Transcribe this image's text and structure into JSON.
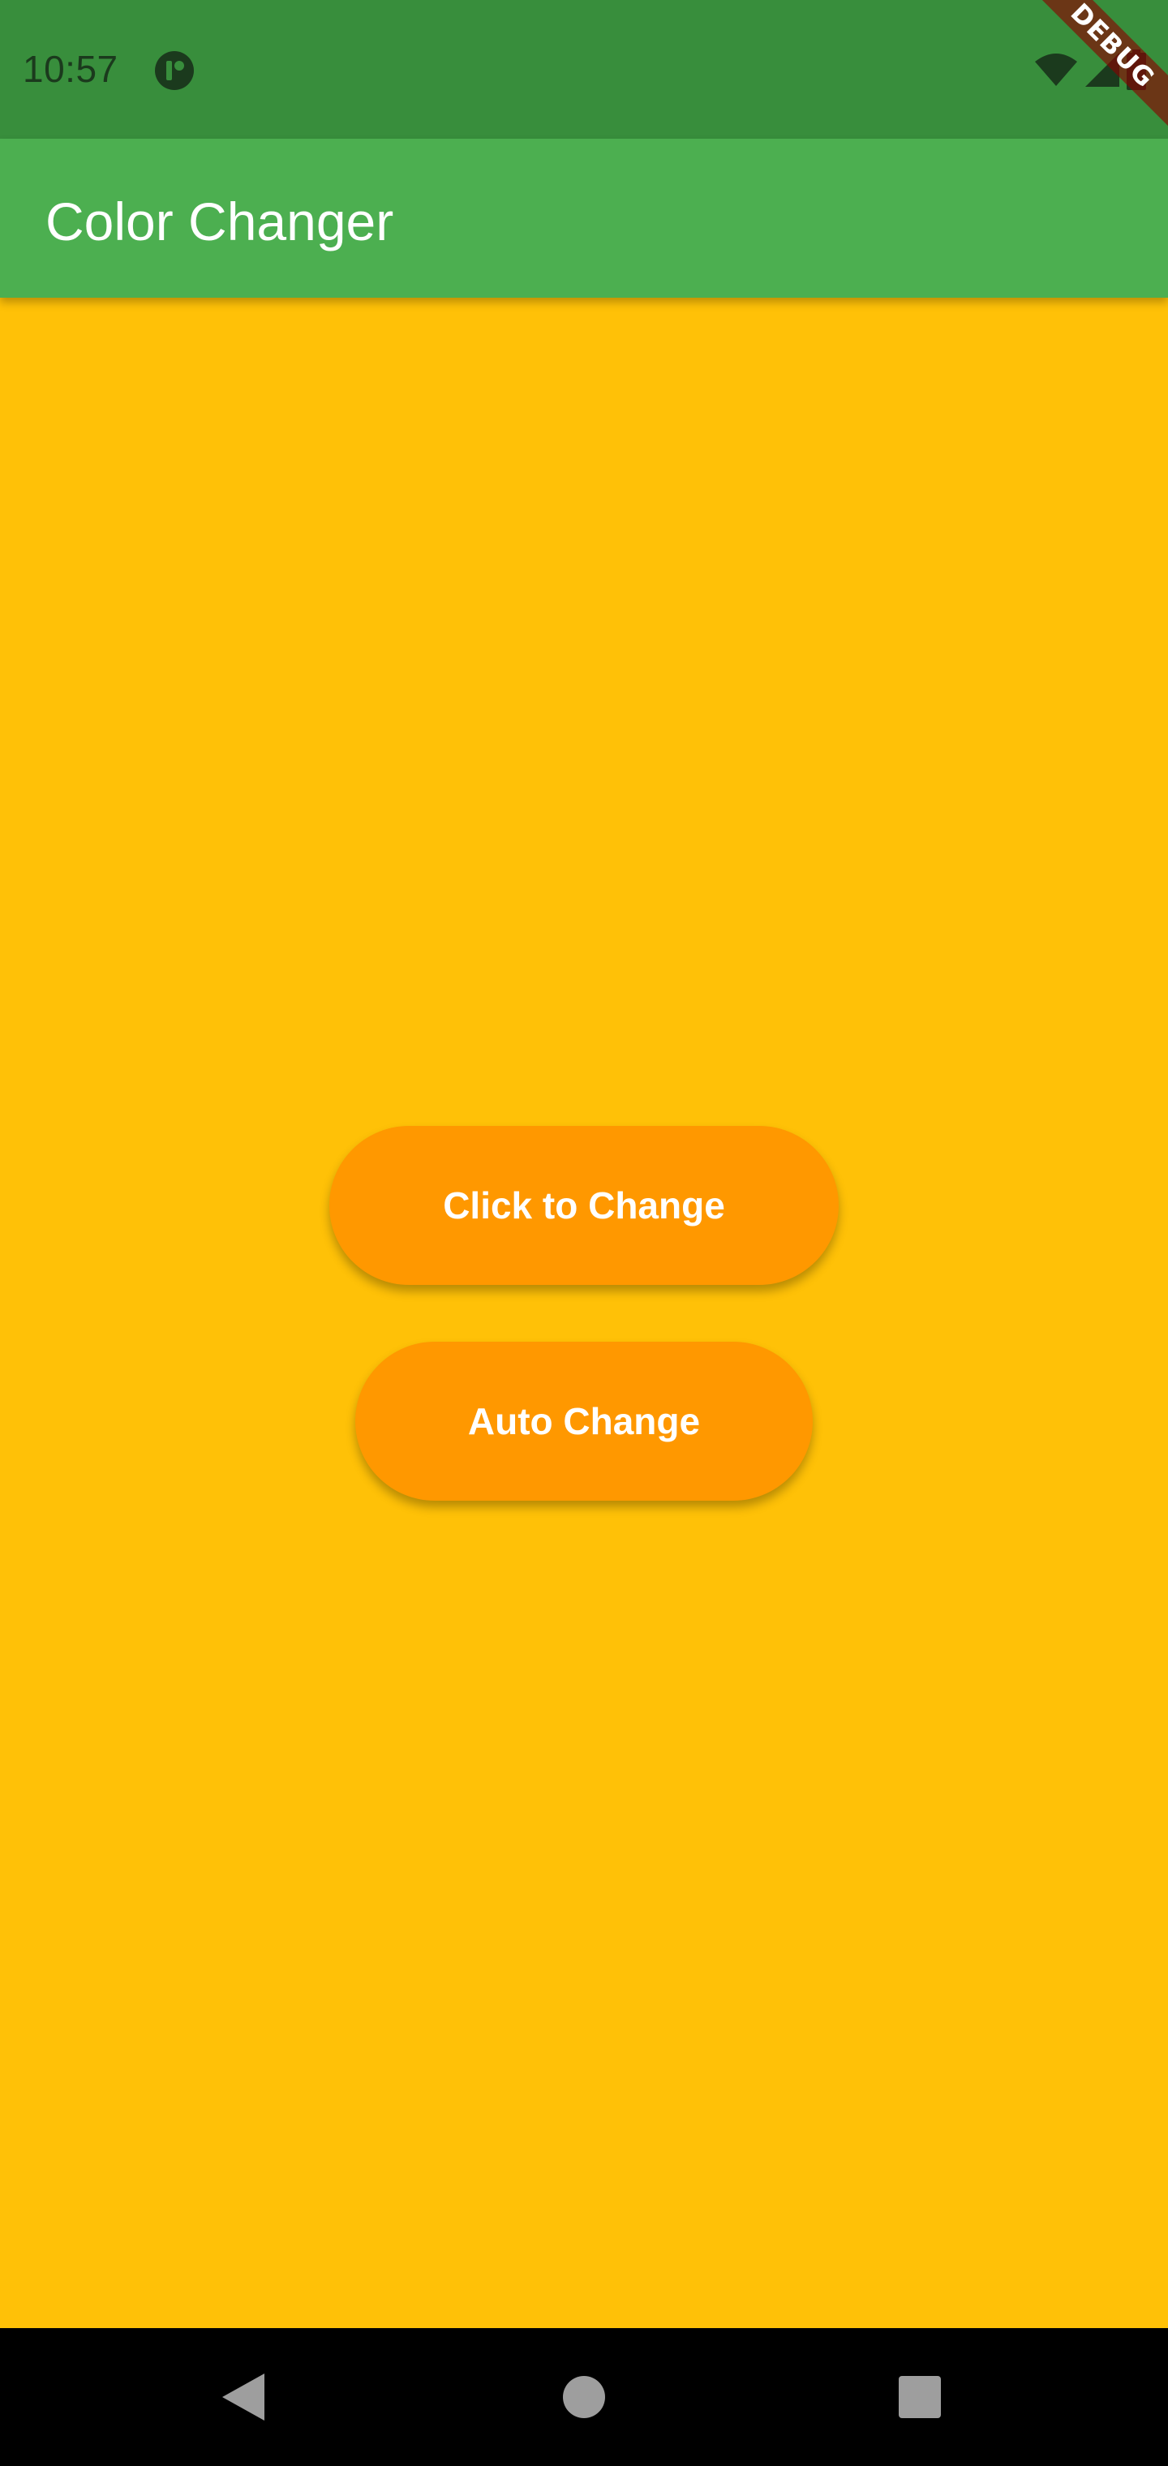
{
  "status_bar": {
    "time": "10:57",
    "icons": [
      "app-notification-icon",
      "wifi-icon",
      "cell-signal-icon",
      "battery-icon"
    ]
  },
  "debug_banner": {
    "label": "DEBUG"
  },
  "app_bar": {
    "title": "Color Changer"
  },
  "main": {
    "background_color": "#FFC107",
    "buttons": [
      {
        "label": "Click to Change",
        "color": "#FF9800"
      },
      {
        "label": "Auto Change",
        "color": "#FF9800"
      }
    ]
  },
  "nav_bar": {
    "icons": [
      "back-icon",
      "home-icon",
      "recents-icon"
    ]
  },
  "colors": {
    "status_bar": "#388E3C",
    "app_bar": "#4CAF50",
    "button_text": "#FFFFFF"
  }
}
